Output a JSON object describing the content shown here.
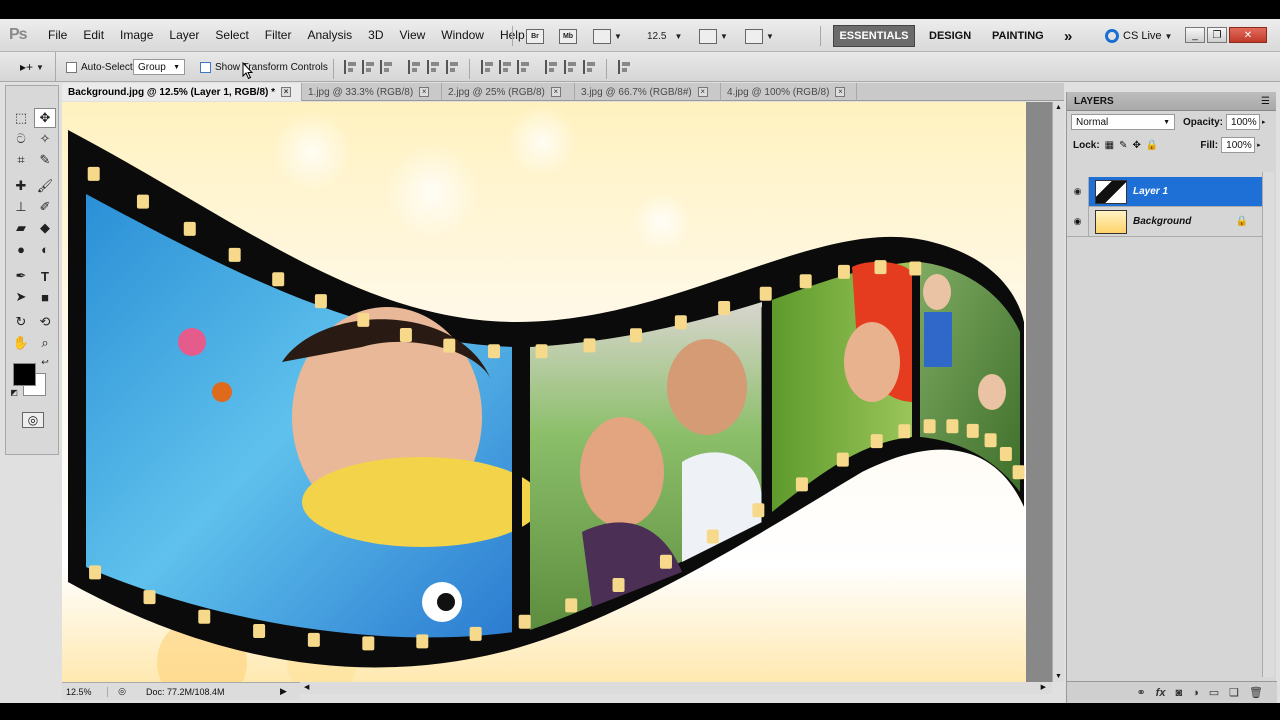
{
  "app": {
    "logo": "Ps"
  },
  "menu": [
    "File",
    "Edit",
    "Image",
    "Layer",
    "Select",
    "Filter",
    "Analysis",
    "3D",
    "View",
    "Window",
    "Help"
  ],
  "menubar": {
    "bridge": "Br",
    "minibridge": "Mb",
    "zoom_value": "12.5",
    "workspaces": {
      "essentials": "ESSENTIALS",
      "design": "DESIGN",
      "painting": "PAINTING",
      "more": "»"
    },
    "cs_live": "CS Live"
  },
  "options": {
    "tool_arrow": "▸+",
    "auto_select_label": "Auto-Select:",
    "auto_select_value": "Group",
    "show_transform_label": "Show Transform Controls"
  },
  "document": {
    "tabs": [
      {
        "label": "Background.jpg @ 12.5% (Layer 1, RGB/8) *",
        "active": true
      },
      {
        "label": "1.jpg @ 33.3% (RGB/8)",
        "active": false
      },
      {
        "label": "2.jpg @ 25% (RGB/8)",
        "active": false
      },
      {
        "label": "3.jpg @ 66.7% (RGB/8#)",
        "active": false
      },
      {
        "label": "4.jpg @ 100% (RGB/8)",
        "active": false
      }
    ],
    "status_zoom": "12.5%",
    "status_doc": "Doc: 77.2M/108.4M"
  },
  "layers": {
    "title": "LAYERS",
    "blend_mode": "Normal",
    "opacity_label": "Opacity:",
    "opacity_value": "100%",
    "lock_label": "Lock:",
    "fill_label": "Fill:",
    "fill_value": "100%",
    "items": [
      {
        "name": "Layer 1",
        "selected": true
      },
      {
        "name": "Background",
        "selected": false
      }
    ]
  },
  "colors": {
    "accent": "#1e6fd6",
    "workspace_active": "#6b6b6b",
    "close_button": "#c93c2d"
  }
}
